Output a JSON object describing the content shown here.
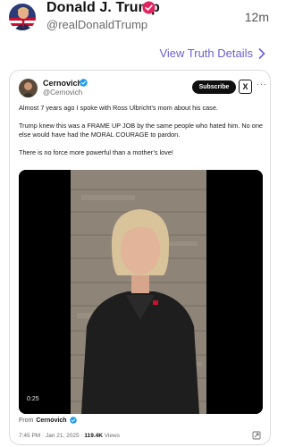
{
  "post": {
    "display_name": "Donald J. Trump",
    "handle": "@realDonaldTrump",
    "timestamp": "12m",
    "view_details_label": "View Truth Details",
    "verified_color": "#e0245e"
  },
  "embed": {
    "author_name": "Cernovich",
    "author_handle": "@Cernovich",
    "subscribe_label": "Subscribe",
    "x_logo_text": "X",
    "more_icon": "···",
    "paragraphs": [
      "Almost 7 years ago I spoke with Ross Ulbricht’s mom about his case.",
      "Trump knew this was a FRAME UP JOB by the same people who hated him. No one else would have had the MORAL COURAGE to pardon.",
      "There is no force more powerful than a mother’s love!"
    ],
    "video_duration": "0:25",
    "from_prefix": "From",
    "from_name": "Cernovich",
    "date_line": "7:45 PM · Jan 21, 2025 · ",
    "views_count": "119.4K",
    "views_label": " Views",
    "verified_color": "#1d9bf0"
  }
}
